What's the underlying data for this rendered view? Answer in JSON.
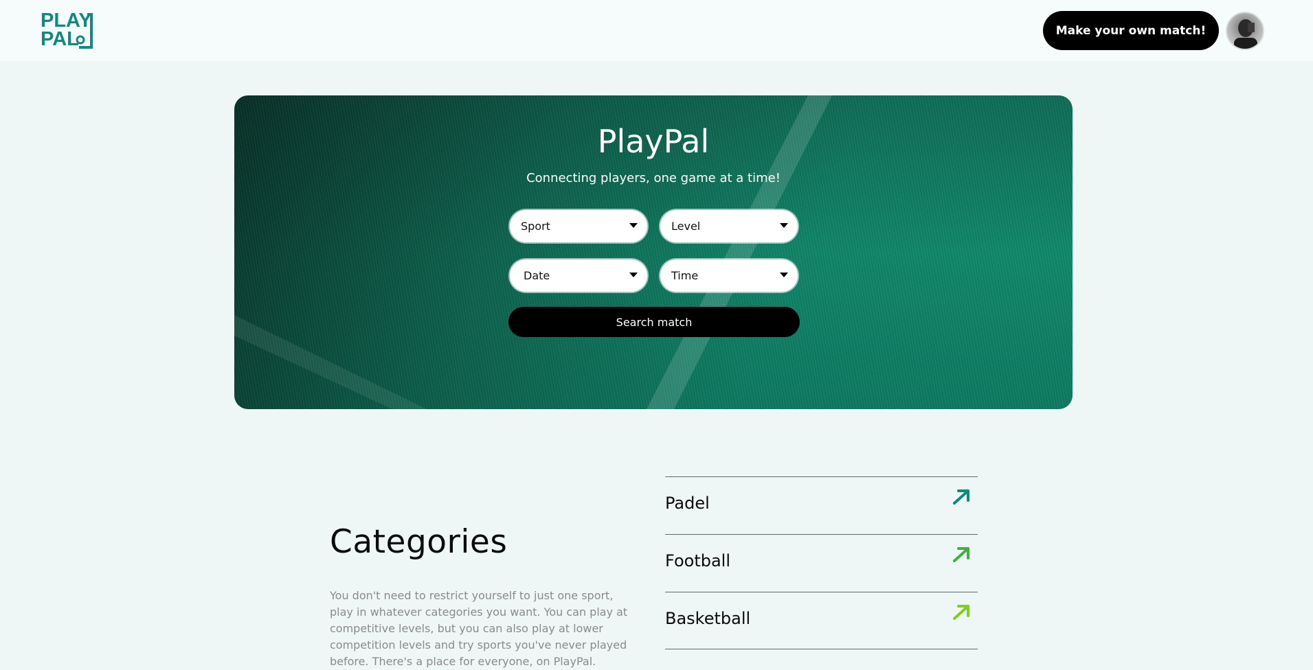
{
  "header": {
    "logo_line1": "PLAY",
    "logo_line2": "PAL",
    "cta_label": "Make your own match!",
    "brand_color": "#0e8a7e"
  },
  "hero": {
    "title": "PlayPal",
    "subtitle": "Connecting players, one game at a time!",
    "filters": {
      "sport": "Sport",
      "level": "Level",
      "date": "Date",
      "time": "Time"
    },
    "search_label": "Search match"
  },
  "categories": {
    "title": "Categories",
    "description": "You don't need to restrict yourself to just one sport, play in whatever categories you want. You can play at competitive levels, but you can also play at lower competition levels and try sports you've never played before. There's a place for everyone, on PlayPal.",
    "items": [
      {
        "label": "Padel",
        "arrow_color": "#0e8a7e",
        "icon": "arrow-up-right-icon"
      },
      {
        "label": "Football",
        "arrow_color": "#3fb13f",
        "icon": "arrow-up-right-icon"
      },
      {
        "label": "Basketball",
        "arrow_color": "#7bd11a",
        "icon": "arrow-up-right-icon"
      }
    ]
  }
}
